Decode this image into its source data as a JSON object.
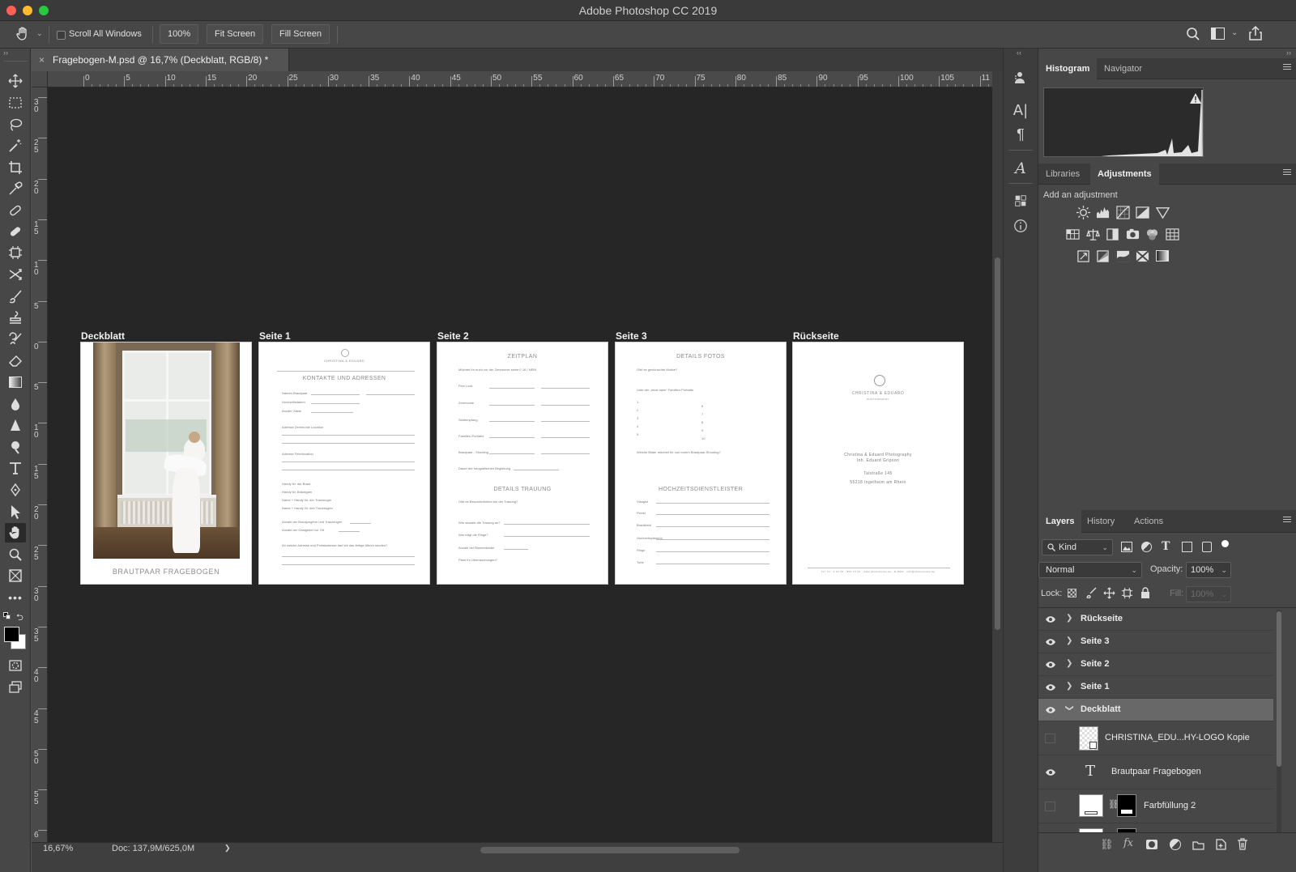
{
  "window": {
    "title": "Adobe Photoshop CC 2019"
  },
  "options_bar": {
    "scroll_all_label": "Scroll All Windows",
    "zoom_btn": "100%",
    "fit_btn": "Fit Screen",
    "fill_btn": "Fill Screen"
  },
  "document": {
    "tab_title": "Fragebogen-M.psd @ 16,7% (Deckblatt, RGB/8) *",
    "close": "×"
  },
  "ruler": {
    "top_ticks": [
      "0",
      "5",
      "10",
      "15",
      "20",
      "25",
      "30",
      "35",
      "40",
      "45",
      "50",
      "55",
      "60",
      "65",
      "70",
      "75",
      "80",
      "85",
      "90",
      "95",
      "100",
      "105",
      "11"
    ],
    "left_ticks": [
      "3 0",
      "2 5",
      "2 0",
      "1 5",
      "1 0",
      "5",
      "0",
      "5",
      "1 0",
      "1 5",
      "2 0",
      "2 5",
      "3 0",
      "3 5",
      "4 0",
      "4 5",
      "5 0",
      "5 5",
      "6"
    ]
  },
  "artboards": [
    {
      "label": "Deckblatt",
      "caption": "BRAUTPAAR FRAGEBOGEN"
    },
    {
      "label": "Seite 1",
      "brand": "CHRISTINA & EDUARD",
      "heading": "KONTAKTE UND ADRESSEN",
      "fields": [
        "Namen Brautpaar",
        "Hochzeitsdatum",
        "Anzahl Gäste",
        "Adresse Zeremonie Location",
        "Adresse Feierlocation",
        "Handy Nr. der Braut",
        "Handy Nr. Bräutigam",
        "Name + Handy Nr. der Trauzeugin",
        "Name + Handy Nr. des Trauzeugen",
        "Anzahl der Brautjungfern und Trauzeugen",
        "Anzahl der Gastgeber vor Ort",
        "An welche Adresse und Portaladresse darf ich das fertige Album senden?"
      ]
    },
    {
      "label": "Seite 2",
      "heading": "ZEITPLAN",
      "heading2": "DETAILS TRAUUNG",
      "fields": [
        "Möchtet Ihr euch vor der Zeremonie sehen? JA / NEIN",
        "First Look",
        "Zeremonie",
        "Sektempfang",
        "Familien-Portraits",
        "Brautpaar - Shooting",
        "Dauer der fotografischen Begleitung",
        "Gibt es Besonderheiten bei der Trauung?",
        "Wer standet die Trauung an?",
        "Wer trägt die Ringe?",
        "Anzahl der Blumenkinder",
        "Plant Ihr Überraschungen?"
      ]
    },
    {
      "label": "Seite 3",
      "heading": "DETAILS FOTOS",
      "heading2": "HOCHZEITSDIENSTLEISTER",
      "fields": [
        "Gibt es gewünschte Motive?",
        "Liste der „must have“ Familien-Portraits",
        "Welche Bilder möchtet Ihr von eurem Brautpaar-Shooting?",
        "Visagist",
        "Florist",
        "Brautkleid",
        "Hochzeitsplanerin",
        "Ringe",
        "Torte"
      ]
    },
    {
      "label": "Rückseite",
      "brand": "CHRISTINA & EDUARD",
      "brand_sub": "PHOTOGRAPHY",
      "address": [
        "Christina & Eduard Photography",
        "Inh. Eduard Gripson",
        "Talstraße 145",
        "55218 Ingelheim am Rhein"
      ],
      "footer": "Tel. Nr.: 0 61 32 - 800 13 40 · www.photostudio.de · E-MAIL: info@photostudio.de"
    }
  ],
  "status": {
    "zoom": "16,67%",
    "doc": "Doc: 137,9M/625,0M",
    "arrow": "❯"
  },
  "panels": {
    "top_tabs": [
      "Histogram",
      "Navigator"
    ],
    "mid_tabs": [
      "Libraries",
      "Adjustments"
    ],
    "adjust_label": "Add an adjustment",
    "layer_tabs": [
      "Layers",
      "History",
      "Actions"
    ],
    "kind_label": "Kind",
    "blend_mode": "Normal",
    "opacity_label": "Opacity:",
    "opacity_value": "100%",
    "lock_label": "Lock:",
    "fill_label": "Fill:",
    "fill_value": "100%",
    "layers": [
      {
        "name": "Rückseite",
        "type": "group",
        "visible": true,
        "expanded": false
      },
      {
        "name": "Seite 3",
        "type": "group",
        "visible": true,
        "expanded": false
      },
      {
        "name": "Seite 2",
        "type": "group",
        "visible": true,
        "expanded": false
      },
      {
        "name": "Seite 1",
        "type": "group",
        "visible": true,
        "expanded": false
      },
      {
        "name": "Deckblatt",
        "type": "group",
        "visible": true,
        "expanded": true,
        "selected": true
      },
      {
        "name": "CHRISTINA_EDU...HY-LOGO Kopie",
        "type": "smart-object",
        "visible": false
      },
      {
        "name": "Brautpaar Fragebogen",
        "type": "text",
        "visible": true
      },
      {
        "name": "Farbfüllung 2",
        "type": "fill",
        "visible": false
      }
    ]
  },
  "colors": {
    "ui_dark": "#474747",
    "canvas": "#262626",
    "selected_layer": "#686868"
  }
}
